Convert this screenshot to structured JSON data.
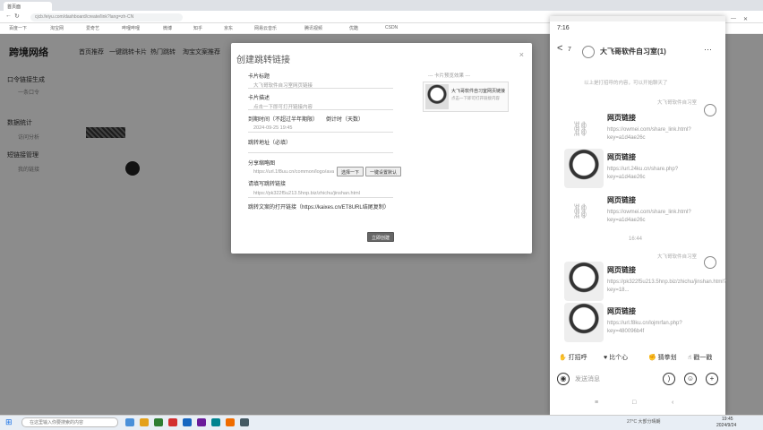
{
  "browser": {
    "tabs": [
      "首页面",
      "",
      "",
      "",
      ""
    ],
    "url": "cjcb.feiyu.com/dashboard/create/link?lang=zh-CN",
    "bookmarks": [
      "百度一下",
      "淘宝网",
      "爱奇艺",
      "哔哩哔哩",
      "微博",
      "知乎",
      "京东",
      "网易云音乐",
      "腾讯视频",
      "优酷",
      "CSDN"
    ]
  },
  "page": {
    "logo": "跨境网络",
    "nav": [
      "首页推荐",
      "一键跳转卡片",
      "热门跳转",
      "淘宝文案推荐"
    ],
    "sidebar": [
      {
        "label": "口令链接生成",
        "sub": "一条口令"
      },
      {
        "label": "数据统计",
        "sub": "访问分析"
      },
      {
        "label": "短链接管理",
        "sub": "我的链接"
      }
    ]
  },
  "modal": {
    "title": "创建跳转链接",
    "close": "×",
    "fields": [
      {
        "label": "卡片标题",
        "value": "大飞哥软件自习室网页链接"
      },
      {
        "label": "卡片描述",
        "value": "点击一下即可打开链接内容"
      },
      {
        "label": "到期时间（不超过半年期限）",
        "value": "2024-09-25 19:45"
      },
      {
        "label": "跳转地址（必填）",
        "value": ""
      },
      {
        "label": "分享缩略图",
        "value": "https://url.1f8uu.cn/common/logo/avatar.jpg"
      },
      {
        "label": "请填写跳转链接",
        "value": "https://pk322f5u213.5hnp.biz/zhichu/jinshan.html"
      },
      {
        "label": "跳转文案的打开链接（https://kaixes.cn/ET8URL结尾复制）",
        "value": ""
      }
    ],
    "timer_label": "倒计时（天数）",
    "btn_upload": "选择一下",
    "btn_default": "一键设置默认",
    "btn_submit": "立即创建",
    "preview_title": "--- 卡片预览效果 ---",
    "preview_card_title": "大飞哥软件自习室网页链接",
    "preview_card_desc": "点击一下即可打开链接内容"
  },
  "phone": {
    "time": "7:16",
    "back": "<",
    "unread": "7",
    "chat_title": "大飞哥软件自习室(1)",
    "more": "···",
    "sys_msg": "以上是打招呼的内容，可以开始聊天了",
    "sender": "大飞哥软件自习室",
    "msgs": [
      {
        "title": "网页链接",
        "link": "https://owmei.com/share_link.html?key=a1d4ae26c"
      },
      {
        "title": "网页链接",
        "link": "https://url.24ku.cn/share.php?key=a1d4ae26c"
      },
      {
        "title": "网页链接",
        "link": "https://owmei.com/share_link.html?key=a1d4ae26c"
      },
      {
        "title": "网页链接",
        "link": "https://pk322f5u213.5hnp.biz/zhichu/jinshan.html?key=18..."
      },
      {
        "title": "网页链接",
        "link": "https://url.f8ku.cn/lojmrfan.php?key=480096b4f"
      }
    ],
    "time_divider": "16:44",
    "actions": [
      "打招呼",
      "比个心",
      "猜拳划",
      "戳一戳"
    ],
    "input_placeholder": "发送消息"
  },
  "taskbar": {
    "search_placeholder": "在这里输入你要搜索的内容",
    "time": "19:45",
    "date": "2024/9/24",
    "weather": "27°C 大部分晴朗"
  }
}
